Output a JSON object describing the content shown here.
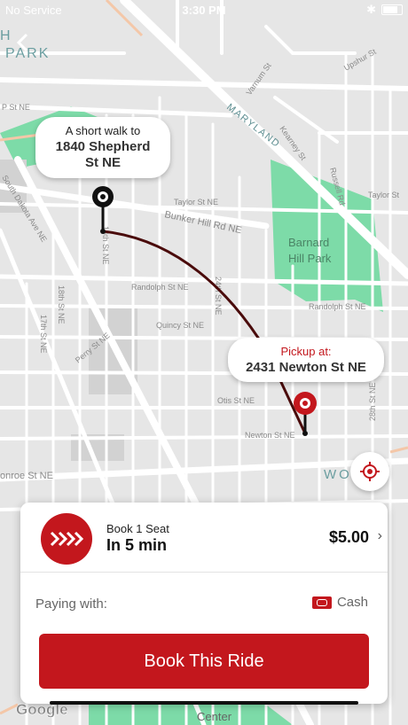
{
  "status_bar": {
    "carrier": "No Service",
    "time": "3:30 PM"
  },
  "map": {
    "labels": {
      "park_top": "PARK",
      "park_top_letter": "H",
      "maryland": "MARYLAND",
      "barnard_park": "Barnard Hill Park",
      "bunker_hill": "Bunker Hill Rd NE",
      "south_dakota": "South Dakota Ave NE",
      "randolph_left": "Randolph St NE",
      "randolph_right": "Randolph St NE",
      "quincy": "Quincy St NE",
      "taylor_top": "Taylor St NE",
      "taylor_right": "Taylor St",
      "otis": "Otis St NE",
      "newton": "Newton St NE",
      "monroe": "onroe St NE",
      "woodridge": "WO  RI",
      "center": "Center",
      "google": "Google",
      "st18": "18th St NE",
      "st19": "19th St NE",
      "st24": "24th St NE",
      "st28": "28th St NE",
      "st17": "17th St NE",
      "perry": "Perry St NE",
      "p_st": "P St NE",
      "varnum": "Varnum St",
      "upshur": "Upshur St",
      "russell": "Russell Rd",
      "hamlin": "Hamlin St",
      "kearney": "Kearney St",
      "otis2": "Otis St"
    },
    "colors": {
      "background": "#e6e6e6",
      "road": "#ffffff",
      "park": "#7ddba8",
      "route": "#4a0b0b",
      "pin_red": "#c3171d"
    }
  },
  "walk_bubble": {
    "line1": "A short walk to",
    "line2": "1840 Shepherd St NE"
  },
  "pickup_bubble": {
    "line1": "Pickup at:",
    "line2": "2431 Newton St NE"
  },
  "ride_option": {
    "subtitle": "Book 1 Seat",
    "eta": "In 5 min",
    "price": "$5.00"
  },
  "payment": {
    "label": "Paying with:",
    "method": "Cash"
  },
  "book_button": "Book This Ride"
}
